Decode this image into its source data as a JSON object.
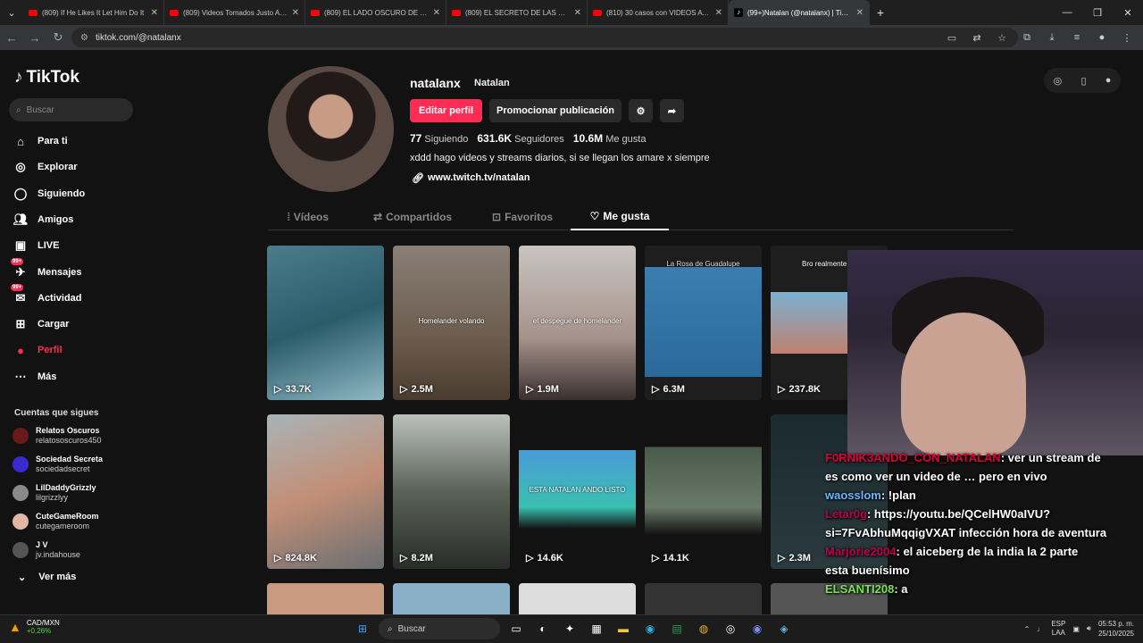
{
  "browser": {
    "tabs": [
      {
        "title": "(809) If He Likes It Let Him Do It",
        "type": "yt"
      },
      {
        "title": "(809) Videos Tomados Justo Antes",
        "type": "yt"
      },
      {
        "title": "(809) EL LADO OSCURO DE LOS",
        "type": "yt"
      },
      {
        "title": "(809) EL SECRETO DE LAS CANCIONES",
        "type": "yt"
      },
      {
        "title": "(810) 30 casos con VIDEOS ATERRADORES",
        "type": "yt"
      },
      {
        "title": "(99+)Natalan (@natalanx) | TikTok",
        "type": "tk"
      }
    ],
    "url": "tiktok.com/@natalanx"
  },
  "sidebar": {
    "logo": "TikTok",
    "search_placeholder": "Buscar",
    "nav": [
      {
        "label": "Para ti",
        "icon": "home-icon"
      },
      {
        "label": "Explorar",
        "icon": "compass-icon"
      },
      {
        "label": "Siguiendo",
        "icon": "following-icon"
      },
      {
        "label": "Amigos",
        "icon": "friends-icon"
      },
      {
        "label": "LIVE",
        "icon": "live-icon"
      },
      {
        "label": "Mensajes",
        "icon": "messages-icon",
        "badge": "99+"
      },
      {
        "label": "Actividad",
        "icon": "activity-icon",
        "badge": "99+"
      },
      {
        "label": "Cargar",
        "icon": "upload-icon"
      },
      {
        "label": "Perfil",
        "icon": "profile-icon",
        "active": true
      },
      {
        "label": "Más",
        "icon": "more-icon"
      }
    ],
    "following_header": "Cuentas que sigues",
    "following": [
      {
        "name": "Relatos Oscuros",
        "handle": "relatososcuros450",
        "color": "#6a1a1a"
      },
      {
        "name": "Sociedad Secreta",
        "handle": "sociedadsecret",
        "color": "#3a2ad0"
      },
      {
        "name": "LilDaddyGrizzly",
        "handle": "lilgrizzlyy",
        "color": "#8a8a8a"
      },
      {
        "name": "CuteGameRoom",
        "handle": "cutegameroom",
        "color": "#e3b6a6"
      },
      {
        "name": "J V",
        "handle": "jv.indahouse",
        "color": "#555"
      }
    ],
    "see_more": "Ver más"
  },
  "profile": {
    "username": "natalanx",
    "display_name": "Natalan",
    "edit_button": "Editar perfil",
    "promote_button": "Promocionar publicación",
    "following_count": "77",
    "following_label": "Siguiendo",
    "followers_count": "631.6K",
    "followers_label": "Seguidores",
    "likes_count": "10.6M",
    "likes_label": "Me gusta",
    "bio": "xddd hago videos y streams diarios, si se llegan los amare x siempre",
    "link": "www.twitch.tv/natalan"
  },
  "tabs": [
    {
      "label": "Vídeos",
      "icon": "grid-icon"
    },
    {
      "label": "Compartidos",
      "icon": "repost-icon"
    },
    {
      "label": "Favoritos",
      "icon": "bookmark-icon"
    },
    {
      "label": "Me gusta",
      "icon": "heart-icon",
      "active": true
    }
  ],
  "videos": [
    {
      "views": "33.7K",
      "caption": "",
      "bg": "linear-gradient(160deg,#4a7c8c,#2a5c6a 50%,#8fb8c4)"
    },
    {
      "views": "2.5M",
      "caption": "Homelander volando",
      "bg": "linear-gradient(180deg,#8a7f76,#6b5c4e 60%,#4a3c30)"
    },
    {
      "views": "1.9M",
      "caption": "el despegue de homelander",
      "bg": "linear-gradient(180deg,#c9c4c0,#a5928a 60%,#3a3030)"
    },
    {
      "views": "6.3M",
      "caption": "La Rosa de Guadalupe",
      "bg": "linear-gradient(180deg,#1e1e1e 0 14%,#3a7fb0 14%,#2a6a9a 85%,#1e1e1e 85%)"
    },
    {
      "views": "237.8K",
      "caption": "Bro realmente se",
      "bg": "linear-gradient(180deg,#1e1e1e 0 30%,#7ab0d0 30%,#c08070 70%,#1e1e1e 70%)"
    },
    {
      "views": "824.8K",
      "caption": "",
      "bg": "linear-gradient(160deg,#a8b4b8,#c28f76 50%,#6a6e72)"
    },
    {
      "views": "8.2M",
      "caption": "",
      "bg": "linear-gradient(180deg,#bcc0bc,#5a6258 50%,#2a2c2a)"
    },
    {
      "views": "14.6K",
      "caption": "ESTA NATALAN ANDO LISTO",
      "bg": "linear-gradient(180deg,#121212 0 23%,#4a9bd8 23%,#3ac0b0 60%,#121212 74%)"
    },
    {
      "views": "14.1K",
      "caption": "",
      "bg": "linear-gradient(180deg,#121212 0 21%,#4a5a4a 21%,#6a7a6a 60%,#121212 78%)"
    },
    {
      "views": "2.3M",
      "caption": "",
      "bg": "linear-gradient(180deg,#1a2a2e,#2a3a3e)"
    }
  ],
  "stream_chat": [
    {
      "user": "F0RNIK3ANDO_CON_NATALAN",
      "text": ": ver un stream de",
      "cls": "u1"
    },
    {
      "user": "",
      "text": "es como ver un video de … pero en vivo",
      "cls": ""
    },
    {
      "user": "waosslom",
      "text": ": !plan",
      "cls": "u2"
    },
    {
      "user": "Letar0g",
      "text": ": https://youtu.be/QCelHW0aIVU?",
      "cls": "u3"
    },
    {
      "user": "",
      "text": "si=7FvAbhuMqqigVXAT infección hora de aventura",
      "cls": ""
    },
    {
      "user": "Marjorie2004",
      "text": ": el aiceberg de la india la 2 parte",
      "cls": "u4"
    },
    {
      "user": "",
      "text": "esta buenísimo",
      "cls": ""
    },
    {
      "user": "ELSANTI208",
      "text": ": a",
      "cls": "u5"
    }
  ],
  "taskbar": {
    "stock_name": "CAD/MXN",
    "stock_change": "+0.26%",
    "search": "Buscar",
    "lang1": "ESP",
    "lang2": "LAA",
    "time": "05:53 p. m.",
    "date": "25/10/2025"
  }
}
